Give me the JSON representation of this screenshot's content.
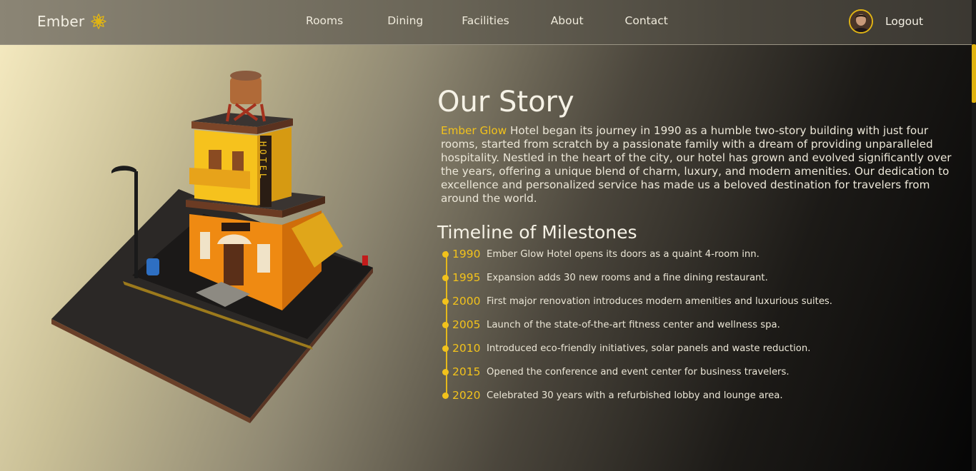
{
  "nav": {
    "brand": "Ember",
    "links": [
      "Rooms",
      "Dining",
      "Facilities",
      "About",
      "Contact"
    ],
    "logout": "Logout"
  },
  "story": {
    "title": "Our Story",
    "highlight": "Ember Glow",
    "body": " Hotel began its journey in 1990 as a humble two-story building with just four rooms, started from scratch by a passionate family with a dream of providing unparalleled hospitality. Nestled in the heart of the city, our hotel has grown and evolved significantly over the years, offering a unique blend of charm, luxury, and modern amenities. Our dedication to excellence and personalized service has made us a beloved destination for travelers from around the world."
  },
  "timeline": {
    "title": "Timeline of Milestones",
    "items": [
      {
        "year": "1990",
        "text": "Ember Glow Hotel opens its doors as a quaint 4-room inn."
      },
      {
        "year": "1995",
        "text": "Expansion adds 30 new rooms and a fine dining restaurant."
      },
      {
        "year": "2000",
        "text": "First major renovation introduces modern amenities and luxurious suites."
      },
      {
        "year": "2005",
        "text": "Launch of the state-of-the-art fitness center and wellness spa."
      },
      {
        "year": "2010",
        "text": "Introduced eco-friendly initiatives, solar panels and waste reduction."
      },
      {
        "year": "2015",
        "text": "Opened the conference and event center for business travelers."
      },
      {
        "year": "2020",
        "text": "Celebrated 30 years with a refurbished lobby and lounge area."
      }
    ]
  },
  "illustration": {
    "sign": "HOTEL"
  },
  "colors": {
    "accent": "#f2c21c",
    "nav_bg": "#6a6557",
    "text": "#ece7d8"
  }
}
